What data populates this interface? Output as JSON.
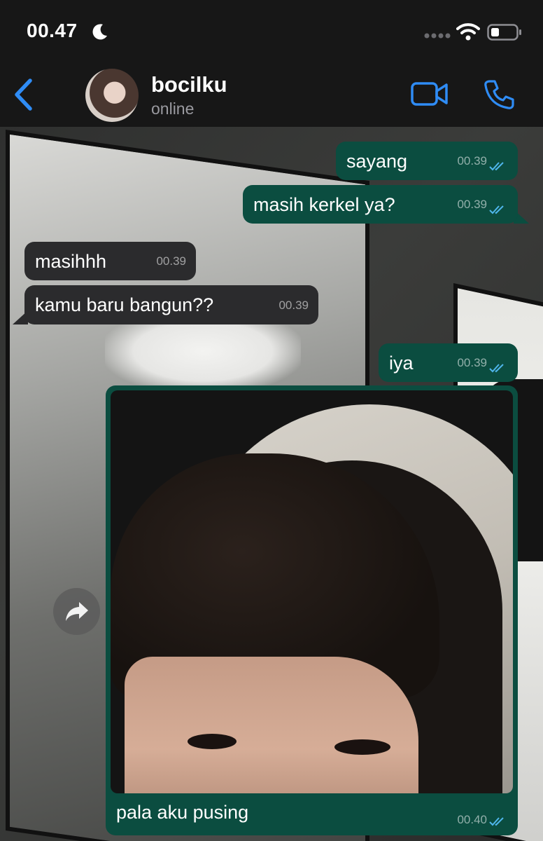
{
  "status_bar": {
    "time": "00.47",
    "icons": [
      "moon-icon",
      "signal-icon",
      "wifi-icon",
      "battery-icon"
    ]
  },
  "header": {
    "back_icon": "chevron-left-icon",
    "contact_name": "bocilku",
    "contact_status": "online",
    "actions": [
      "video-call-icon",
      "phone-icon"
    ]
  },
  "colors": {
    "accent": "#2f8cf5",
    "outgoing_bubble": "#0b4d40",
    "incoming_bubble": "#2b2b2d",
    "read_ticks": "#4fb6ec"
  },
  "messages": [
    {
      "direction": "out",
      "text": "sayang",
      "time": "00.39",
      "read": true
    },
    {
      "direction": "out",
      "text": "masih kerkel ya?",
      "time": "00.39",
      "read": true
    },
    {
      "direction": "in",
      "text": "masihhh",
      "time": "00.39"
    },
    {
      "direction": "in",
      "text": "kamu baru bangun??",
      "time": "00.39"
    },
    {
      "direction": "out",
      "text": "iya",
      "time": "00.39",
      "read": true
    },
    {
      "direction": "out",
      "type": "photo",
      "caption": "pala aku pusing",
      "time": "00.40",
      "read": true
    }
  ],
  "forward_icon": "share-forward-icon"
}
